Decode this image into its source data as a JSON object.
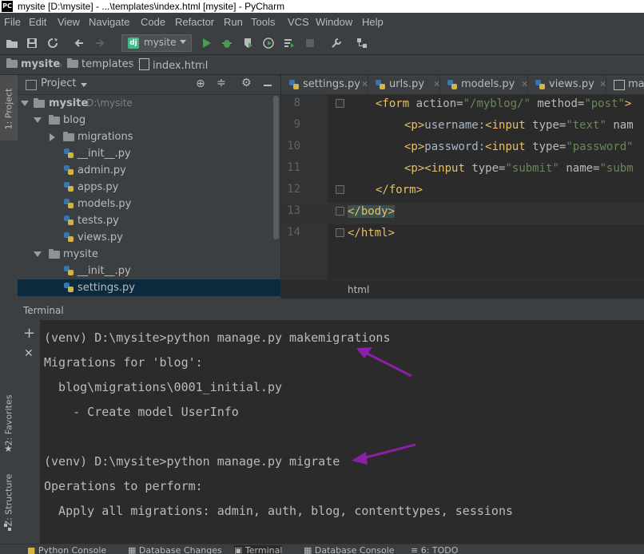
{
  "window": {
    "title": "mysite [D:\\mysite] - ...\\templates\\index.html [mysite] - PyCharm"
  },
  "menu": [
    "File",
    "Edit",
    "View",
    "Navigate",
    "Code",
    "Refactor",
    "Run",
    "Tools",
    "VCS",
    "Window",
    "Help"
  ],
  "toolbar": {
    "run_config": "mysite",
    "django_badge": "dj"
  },
  "breadcrumb": {
    "project": "mysite",
    "folder": "templates",
    "file": "index.html"
  },
  "left_strip": {
    "project_tab": "1: Project",
    "favorites_tab": "2: Favorites",
    "structure_tab": "Z: Structure"
  },
  "project_panel": {
    "title": "Project",
    "tree": [
      {
        "label": "mysite",
        "path": "D:\\mysite"
      },
      {
        "label": "blog"
      },
      {
        "label": "migrations"
      },
      {
        "label": "__init__.py"
      },
      {
        "label": "admin.py"
      },
      {
        "label": "apps.py"
      },
      {
        "label": "models.py"
      },
      {
        "label": "tests.py"
      },
      {
        "label": "views.py"
      },
      {
        "label": "mysite"
      },
      {
        "label": "__init__.py"
      },
      {
        "label": "settings.py"
      }
    ]
  },
  "editor": {
    "tabs": [
      "settings.py",
      "urls.py",
      "models.py",
      "views.py",
      "ma"
    ],
    "line_numbers": [
      "8",
      "9",
      "10",
      "11",
      "12",
      "13",
      "14"
    ],
    "bottom_crumb": "html",
    "lines": [
      {
        "tag_open": "<form ",
        "a1": "action=",
        "v1": "\"/myblog/\"",
        "a2": " method=",
        "v2": "\"post\"",
        "tail": ">"
      },
      {
        "t1": "<p>",
        "txt": "username:",
        "t2": "<input ",
        "a": "type=",
        "v": "\"text\"",
        "tail": " nam"
      },
      {
        "t1": "<p>",
        "txt": "password:",
        "t2": "<input ",
        "a": "type=",
        "v": "\"password\"",
        "tail": ""
      },
      {
        "t1": "<p>",
        "t2": "<input ",
        "a": "type=",
        "v": "\"submit\"",
        "a2": " name=",
        "v2": "\"subm"
      },
      {
        "text": "</form>"
      },
      {
        "text": "</body>"
      },
      {
        "text": "</html>"
      }
    ]
  },
  "terminal": {
    "title": "Terminal",
    "lines": [
      "(venv) D:\\mysite>python manage.py makemigrations",
      "Migrations for 'blog':",
      "  blog\\migrations\\0001_initial.py",
      "    - Create model UserInfo",
      "",
      "(venv) D:\\mysite>python manage.py migrate",
      "Operations to perform:",
      "  Apply all migrations: admin, auth, blog, contenttypes, sessions"
    ],
    "annotation_color": "#8b1fa8"
  },
  "bottom_tabs": [
    "Python Console",
    "Database Changes",
    "Terminal",
    "Database Console",
    "6: TODO"
  ]
}
